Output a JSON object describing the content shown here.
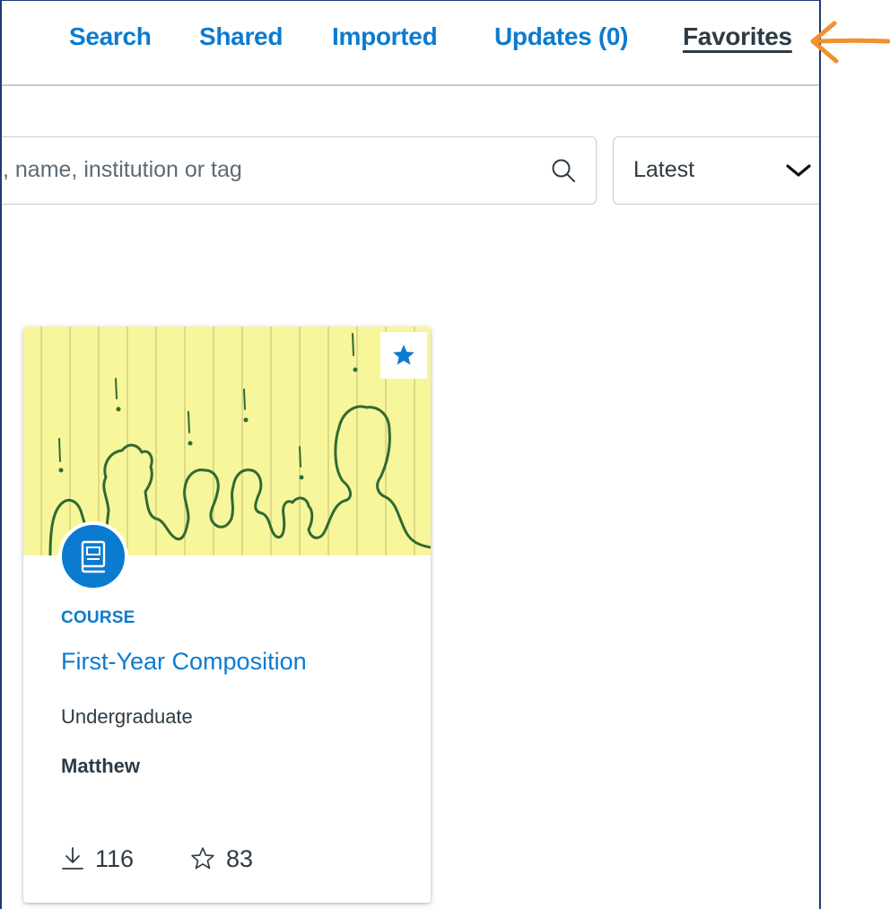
{
  "tabs": [
    {
      "label": "Search",
      "active": false
    },
    {
      "label": "Shared",
      "active": false
    },
    {
      "label": "Imported",
      "active": false
    },
    {
      "label": "Updates (0)",
      "active": false
    },
    {
      "label": "Favorites",
      "active": true
    }
  ],
  "search": {
    "placeholder": ", name, institution or tag",
    "value": "",
    "icon": "search-icon"
  },
  "sort": {
    "selected": "Latest",
    "icon": "chevron-down-icon"
  },
  "card": {
    "favorited": true,
    "favorite_icon": "star-filled-icon",
    "type_icon": "course-book-icon",
    "kind": "COURSE",
    "title": "First-Year Composition",
    "level": "Undergraduate",
    "author": "Matthew",
    "downloads": "116",
    "favorites": "83",
    "download_icon": "download-icon",
    "favorites_icon": "star-outline-icon"
  },
  "annotation": {
    "icon": "arrow-left-icon",
    "color": "#f0912d"
  },
  "colors": {
    "accent": "#0b7bd0",
    "text": "#2d3b45",
    "border": "#c7cdd1",
    "frame": "#1f3a75",
    "image_bg": "#f8f69a",
    "image_ink": "#2e6b35"
  }
}
